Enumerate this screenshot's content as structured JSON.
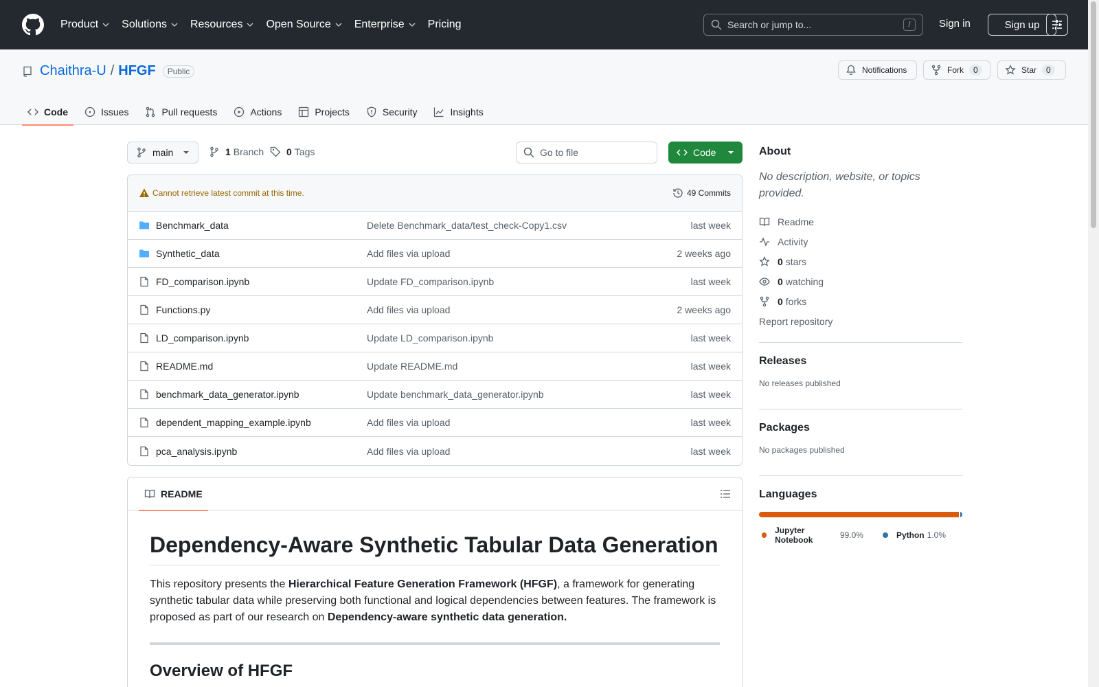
{
  "header": {
    "nav": [
      "Product",
      "Solutions",
      "Resources",
      "Open Source",
      "Enterprise",
      "Pricing"
    ],
    "search_placeholder": "Search or jump to...",
    "search_key": "/",
    "signin": "Sign in",
    "signup": "Sign up"
  },
  "repo": {
    "owner": "Chaithra-U",
    "separator": "/",
    "name": "HFGF",
    "visibility": "Public",
    "notifications": "Notifications",
    "fork_label": "Fork",
    "fork_count": "0",
    "star_label": "Star",
    "star_count": "0"
  },
  "tabs": [
    "Code",
    "Issues",
    "Pull requests",
    "Actions",
    "Projects",
    "Security",
    "Insights"
  ],
  "toolbar": {
    "branch": "main",
    "branch_count": "1",
    "branch_label": "Branch",
    "tag_count": "0",
    "tag_label": "Tags",
    "goto_placeholder": "Go to file",
    "code_button": "Code"
  },
  "files_header": {
    "warning": "Cannot retrieve latest commit at this time.",
    "commits": "49 Commits"
  },
  "files": [
    {
      "type": "folder",
      "name": "Benchmark_data",
      "message": "Delete Benchmark_data/test_check-Copy1.csv",
      "date": "last week"
    },
    {
      "type": "folder",
      "name": "Synthetic_data",
      "message": "Add files via upload",
      "date": "2 weeks ago"
    },
    {
      "type": "file",
      "name": "FD_comparison.ipynb",
      "message": "Update FD_comparison.ipynb",
      "date": "last week"
    },
    {
      "type": "file",
      "name": "Functions.py",
      "message": "Add files via upload",
      "date": "2 weeks ago"
    },
    {
      "type": "file",
      "name": "LD_comparison.ipynb",
      "message": "Update LD_comparison.ipynb",
      "date": "last week"
    },
    {
      "type": "file",
      "name": "README.md",
      "message": "Update README.md",
      "date": "last week"
    },
    {
      "type": "file",
      "name": "benchmark_data_generator.ipynb",
      "message": "Update benchmark_data_generator.ipynb",
      "date": "last week"
    },
    {
      "type": "file",
      "name": "dependent_mapping_example.ipynb",
      "message": "Add files via upload",
      "date": "last week"
    },
    {
      "type": "file",
      "name": "pca_analysis.ipynb",
      "message": "Add files via upload",
      "date": "last week"
    }
  ],
  "readme": {
    "tab": "README",
    "title": "Dependency-Aware Synthetic Tabular Data Generation",
    "p1_a": "This repository presents the ",
    "p1_b": "Hierarchical Feature Generation Framework (HFGF)",
    "p1_c": ", a framework for generating synthetic tabular data while preserving both functional and logical dependencies between features. The framework is proposed as part of our research on ",
    "p1_d": "Dependency-aware synthetic data generation.",
    "h2": "Overview of HFGF"
  },
  "about": {
    "title": "About",
    "description": "No description, website, or topics provided.",
    "readme": "Readme",
    "activity": "Activity",
    "stars_count": "0",
    "stars_label": "stars",
    "watching_count": "0",
    "watching_label": "watching",
    "forks_count": "0",
    "forks_label": "forks",
    "report": "Report repository"
  },
  "releases": {
    "title": "Releases",
    "text": "No releases published"
  },
  "packages": {
    "title": "Packages",
    "text": "No packages published"
  },
  "languages": {
    "title": "Languages",
    "items": [
      {
        "name": "Jupyter Notebook",
        "pct": "99.0%",
        "value": 99.0,
        "color": "#DA5B0B"
      },
      {
        "name": "Python",
        "pct": "1.0%",
        "value": 1.0,
        "color": "#3572A5"
      }
    ]
  }
}
